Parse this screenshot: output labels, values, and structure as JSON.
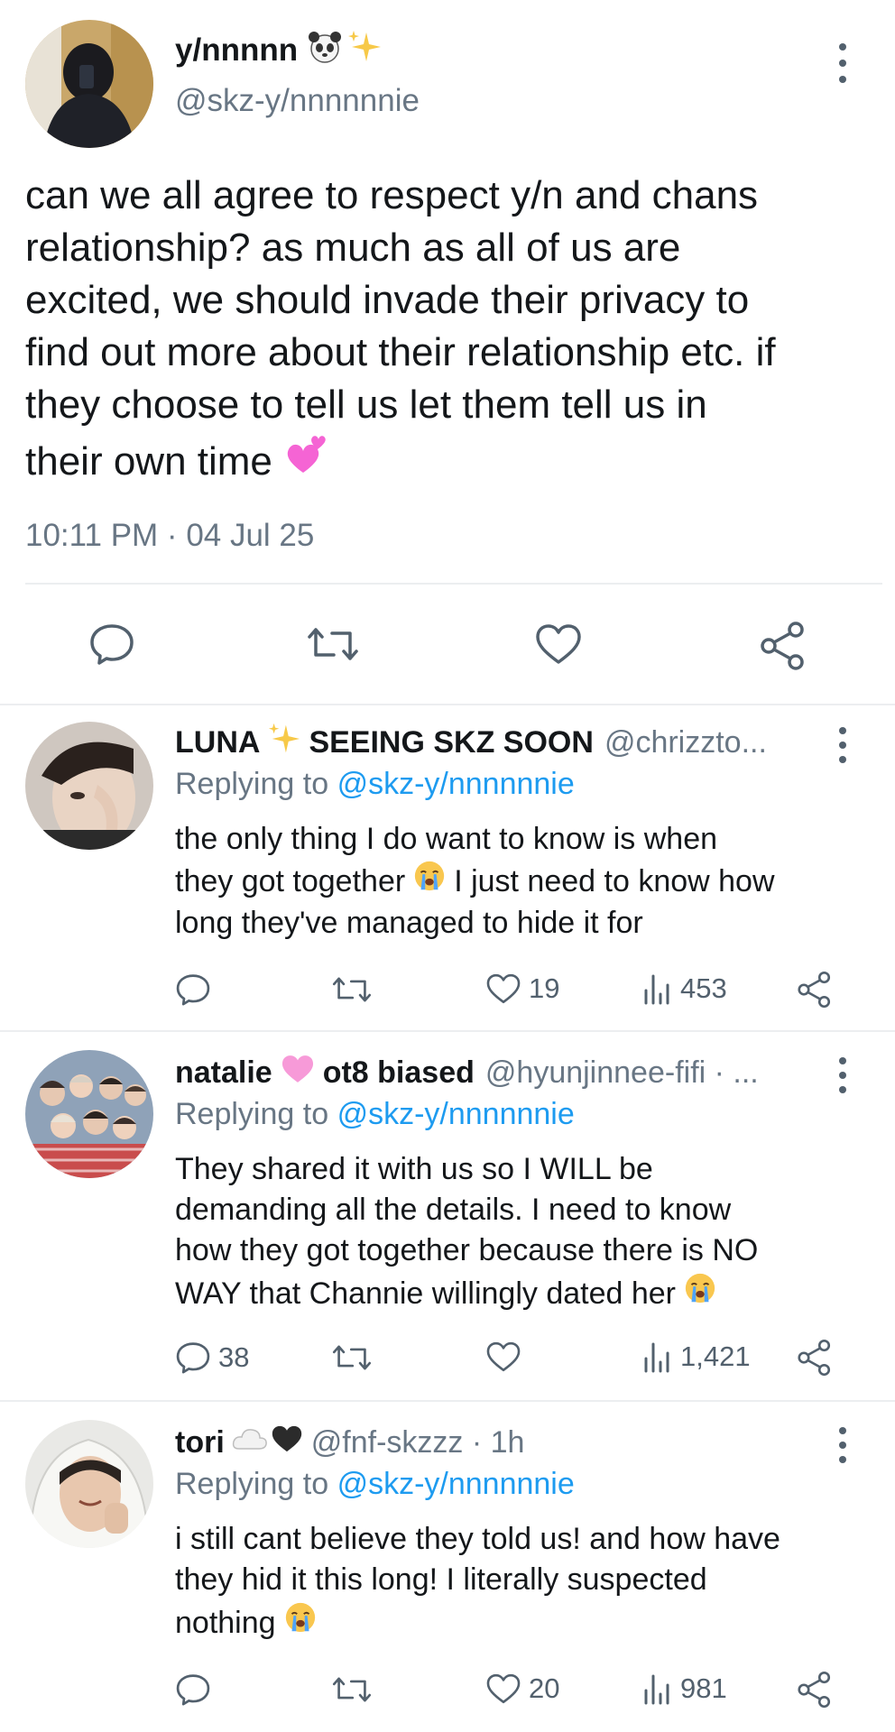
{
  "main_post": {
    "display_name": "y/nnnnn",
    "name_emojis": [
      "panda-emoji",
      "sparkles-emoji"
    ],
    "handle": "@skz-y/nnnnnnie",
    "text_lines": [
      "can we all agree to respect y/n and chans",
      "relationship? as much as all of us are",
      "excited, we should invade their privacy to",
      "find out more about their relationship etc. if",
      "they choose to tell us let them tell us in",
      "their own time"
    ],
    "text_end_emoji": "two-hearts-emoji",
    "timestamp": "10:11 PM · 04 Jul 25"
  },
  "replies": [
    {
      "display_name_a": "LUNA",
      "display_name_b": "SEEING SKZ SOON",
      "handle": "@chrizzto...",
      "replying_prefix": "Replying to",
      "replying_handle": "@skz-y/nnnnnnie",
      "lines": [
        "the only thing I do want to know is when",
        "they got together",
        "I just need to know how",
        "long they've managed to hide it for"
      ],
      "reply_count": "",
      "like_count": "19",
      "view_count": "453"
    },
    {
      "display_name_a": "natalie",
      "display_name_b": "ot8 biased",
      "handle": "@hyunjinnee-fifi · ...",
      "replying_prefix": "Replying to",
      "replying_handle": "@skz-y/nnnnnnie",
      "lines": [
        "They shared it with us so I WILL be",
        "demanding all the details. I need to know",
        "how they got together because there is NO",
        "WAY that Channie willingly dated her"
      ],
      "reply_count": "38",
      "like_count": "",
      "view_count": "1,421"
    },
    {
      "display_name_a": "tori",
      "display_name_b": "",
      "handle": "@fnf-skzzz · 1h",
      "replying_prefix": "Replying to",
      "replying_handle": "@skz-y/nnnnnnie",
      "lines": [
        "i still cant believe they told us! and how have",
        "they hid it this long! I literally suspected",
        "nothing"
      ],
      "reply_count": "",
      "like_count": "20",
      "view_count": "981"
    }
  ],
  "colors": {
    "link": "#1d9bf0",
    "muted": "#687684",
    "icon": "#52606d",
    "divider": "#eceef0"
  }
}
